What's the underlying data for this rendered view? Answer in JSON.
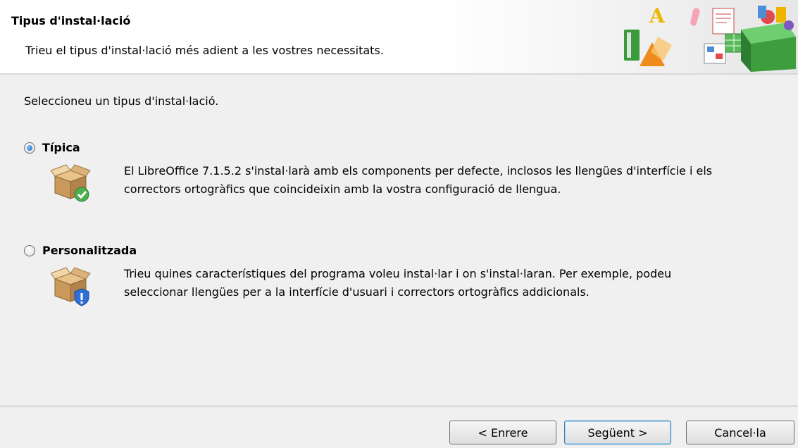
{
  "header": {
    "title": "Tipus d'instal·lació",
    "subtitle": "Trieu el tipus d'instal·lació més adient a les vostres necessitats."
  },
  "prompt": "Seleccioneu un tipus d'instal·lació.",
  "options": [
    {
      "label": "Típica",
      "selected": true,
      "icon": "box-checkmark-icon",
      "description": "El LibreOffice 7.1.5.2 s'instal·larà amb els components per defecte, inclosos les llengües d'interfície i els correctors ortogràfics que coincideixin amb la vostra configuració de llengua."
    },
    {
      "label": "Personalitzada",
      "selected": false,
      "icon": "box-shield-icon",
      "description": "Trieu quines característiques del programa voleu instal·lar i on s'instal·laran. Per exemple, podeu seleccionar llengües per a la interfície d'usuari i correctors ortogràfics addicionals."
    }
  ],
  "buttons": {
    "back": "< Enrere",
    "next": "Següent >",
    "cancel": "Cancel·la"
  },
  "colors": {
    "accent": "#1a5fb4",
    "check_green": "#4caf50",
    "shield_blue": "#2f6fd6"
  }
}
